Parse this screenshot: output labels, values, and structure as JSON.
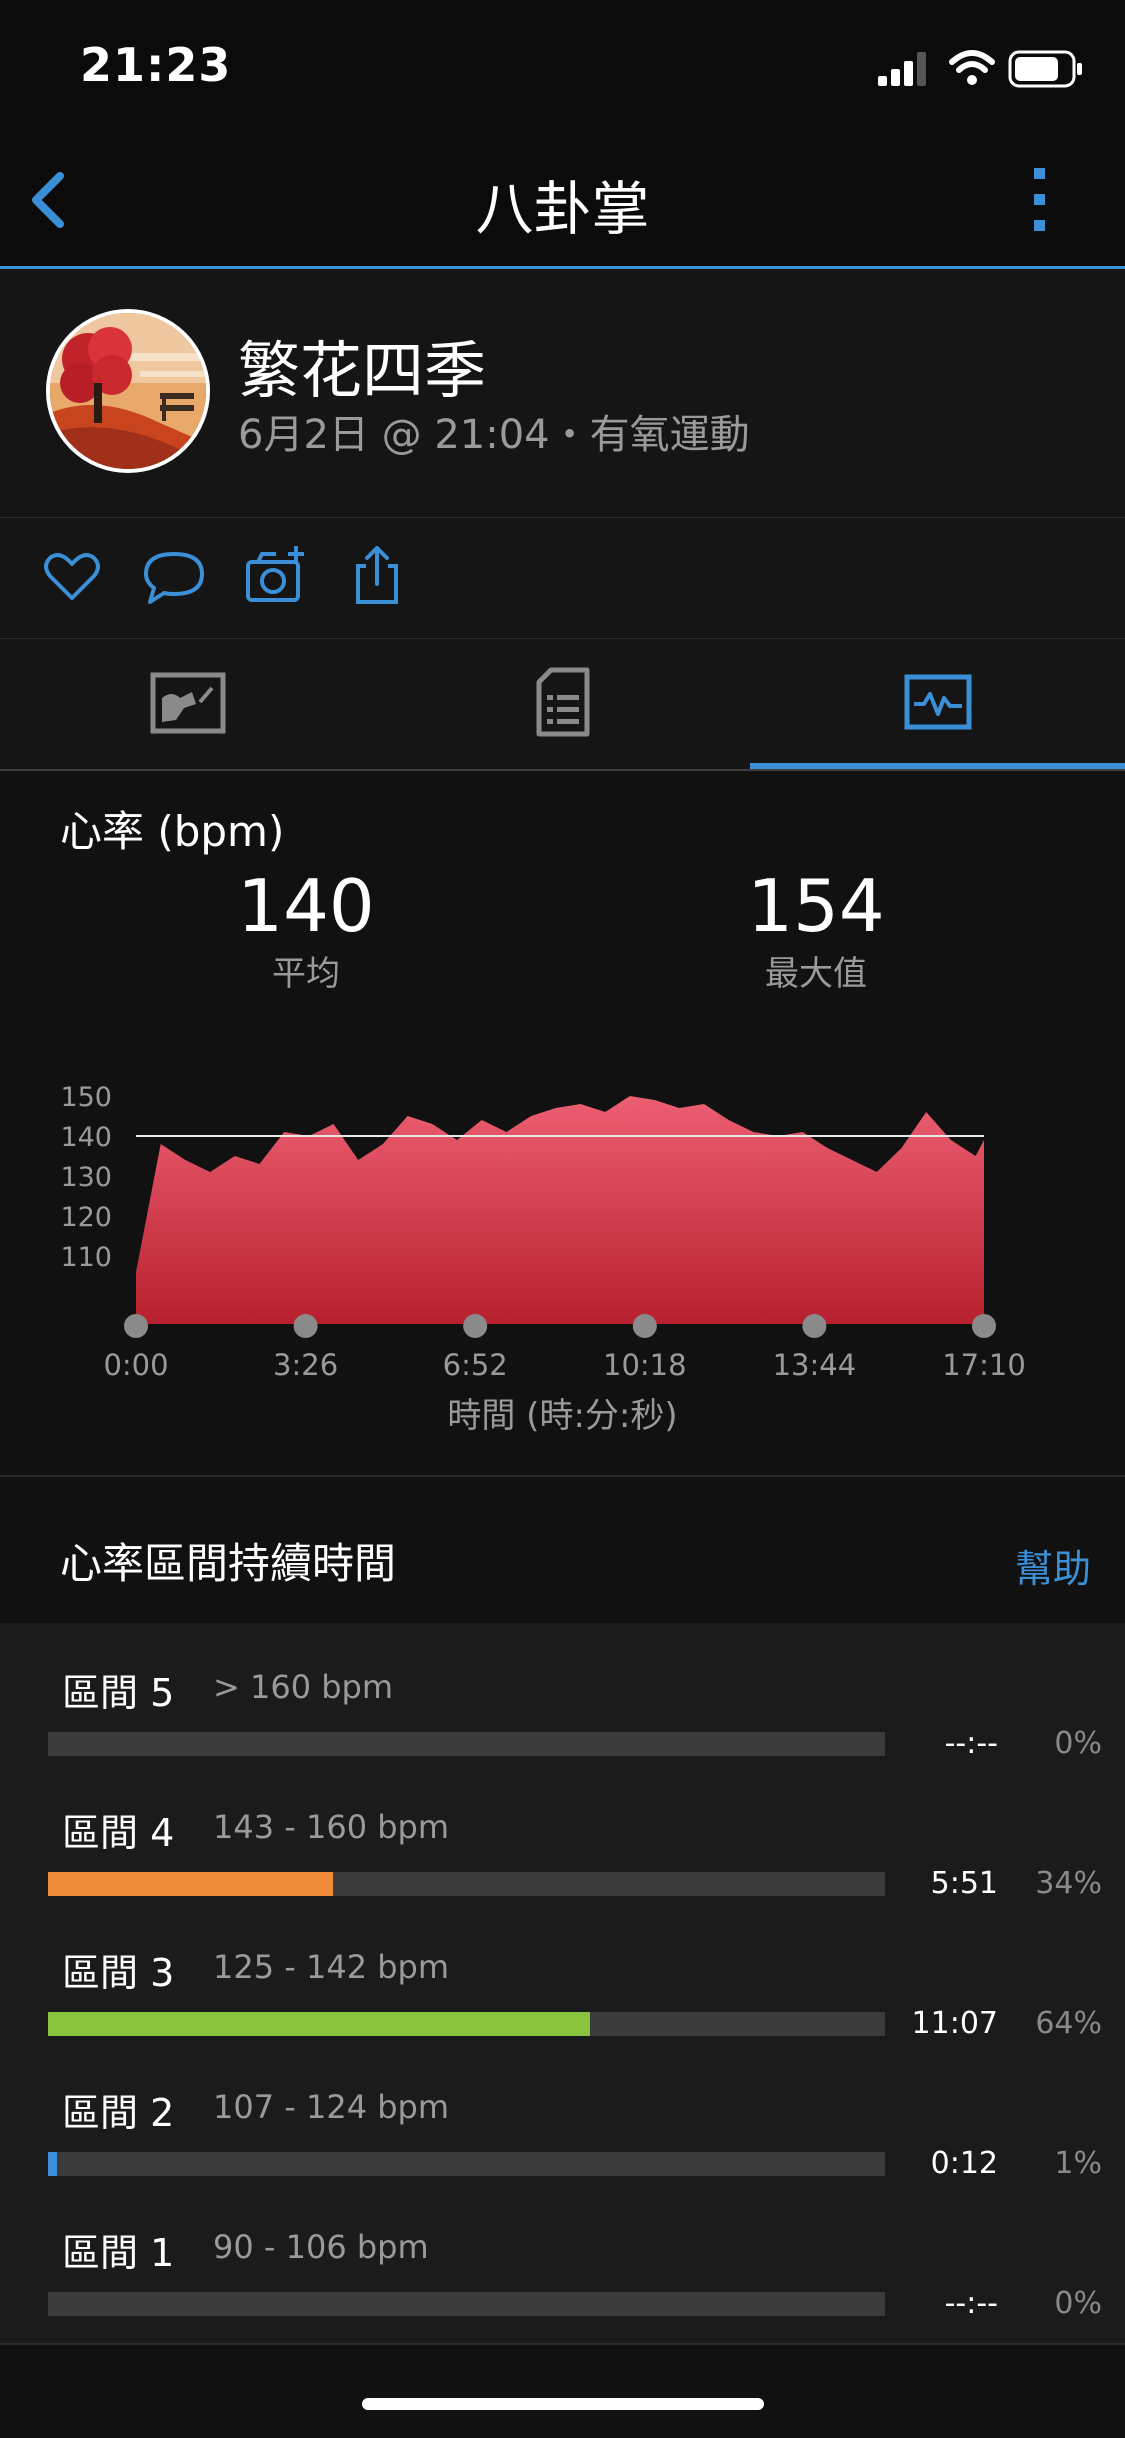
{
  "status_bar": {
    "time": "21:23",
    "battery_level": 0.8
  },
  "nav": {
    "title": "八卦掌",
    "back_icon": "chevron-left-icon",
    "more_icon": "more-vertical-icon"
  },
  "activity": {
    "name": "繁花四季",
    "meta": "6月2日 @ 21:04・有氧運動"
  },
  "social": {
    "icons": [
      "heart-icon",
      "comment-icon",
      "add-photo-icon",
      "share-icon"
    ]
  },
  "tabs": [
    {
      "icon": "map-icon",
      "selected": false
    },
    {
      "icon": "details-icon",
      "selected": false
    },
    {
      "icon": "chart-icon",
      "selected": true
    }
  ],
  "heart_rate": {
    "label": "心率 (bpm)",
    "avg_value": "140",
    "avg_label": "平均",
    "max_value": "154",
    "max_label": "最大值",
    "x_axis_title": "時間 (時:分:秒)"
  },
  "chart_data": {
    "type": "area",
    "title": "",
    "xlabel": "時間 (時:分:秒)",
    "ylabel": "",
    "x_tick_labels": [
      "0:00",
      "3:26",
      "6:52",
      "10:18",
      "13:44",
      "17:10"
    ],
    "y_tick_labels": [
      "150",
      "140",
      "130",
      "120",
      "110"
    ],
    "y_ticks": [
      150,
      140,
      130,
      120,
      110
    ],
    "ylim": [
      103,
      152
    ],
    "reference_line": 140,
    "x_minutes": [
      0,
      0.5,
      1,
      1.5,
      2,
      2.5,
      3,
      3.5,
      4,
      4.5,
      5,
      5.5,
      6,
      6.5,
      7,
      7.5,
      8,
      8.5,
      9,
      9.5,
      10,
      10.5,
      11,
      11.5,
      12,
      12.5,
      13,
      13.5,
      14,
      14.5,
      15,
      15.5,
      16,
      16.5,
      17,
      17.17
    ],
    "series": [
      {
        "values": [
          106,
          138,
          134,
          131,
          135,
          133,
          141,
          140,
          143,
          134,
          138,
          145,
          143,
          139,
          144,
          141,
          145,
          147,
          148,
          146,
          150,
          149,
          147,
          148,
          144,
          141,
          140,
          141,
          137,
          134,
          131,
          137,
          146,
          139,
          135,
          139
        ]
      }
    ],
    "fill_color": "#d63a4e",
    "grid": false
  },
  "zones": {
    "title": "心率區間持續時間",
    "help_label": "幫助",
    "items": [
      {
        "name": "區間 5",
        "range": "> 160 bpm",
        "time": "--:--",
        "percent": "0%",
        "fraction": 0.0,
        "color": "#888888"
      },
      {
        "name": "區間 4",
        "range": "143 - 160 bpm",
        "time": "5:51",
        "percent": "34%",
        "fraction": 0.34,
        "color": "#ee8c3c"
      },
      {
        "name": "區間 3",
        "range": "125 - 142 bpm",
        "time": "11:07",
        "percent": "64%",
        "fraction": 0.648,
        "color": "#8ac43f"
      },
      {
        "name": "區間 2",
        "range": "107 - 124 bpm",
        "time": "0:12",
        "percent": "1%",
        "fraction": 0.011,
        "color": "#3a8fd6"
      },
      {
        "name": "區間 1",
        "range": "90 - 106 bpm",
        "time": "--:--",
        "percent": "0%",
        "fraction": 0.0,
        "color": "#888888"
      }
    ]
  },
  "colors": {
    "accent": "#3a8fd6",
    "background": "#111111",
    "chart_fill": "#d63a4e"
  }
}
